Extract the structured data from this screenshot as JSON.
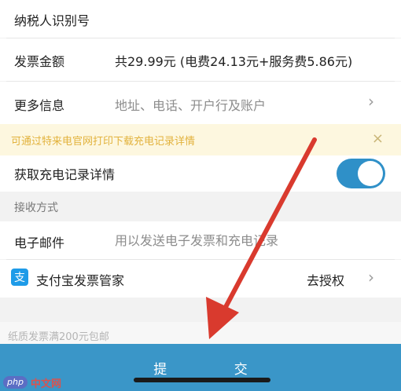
{
  "rows": {
    "tax_id": {
      "label": "纳税人识别号"
    },
    "amount": {
      "label": "发票金额",
      "value": "共29.99元 (电费24.13元+服务费5.86元)"
    },
    "more_info": {
      "label": "更多信息",
      "placeholder": "地址、电话、开户行及账户",
      "chevron": "›"
    },
    "charge_record": {
      "label": "获取充电记录详情",
      "toggle_on": true
    },
    "email": {
      "label": "电子邮件",
      "placeholder": "用以发送电子发票和充电记录"
    },
    "alipay": {
      "icon": "alipay-icon",
      "icon_glyph": "支",
      "label": "支付宝发票管家",
      "action": "去授权",
      "chevron": "›"
    }
  },
  "notice": {
    "text": "可通过特来电官网打印下载充电记录详情",
    "close": "×"
  },
  "section_header": "接收方式",
  "paper_note": "纸质发票满200元包邮",
  "submit": {
    "label": "提 交"
  },
  "watermark": {
    "badge": "php",
    "text": "中文网"
  },
  "colors": {
    "accent": "#3a96c8",
    "toggle": "#2f90c8",
    "notice_bg": "#fdf7df",
    "notice_text": "#e2b23c",
    "arrow": "#d93a2e"
  }
}
